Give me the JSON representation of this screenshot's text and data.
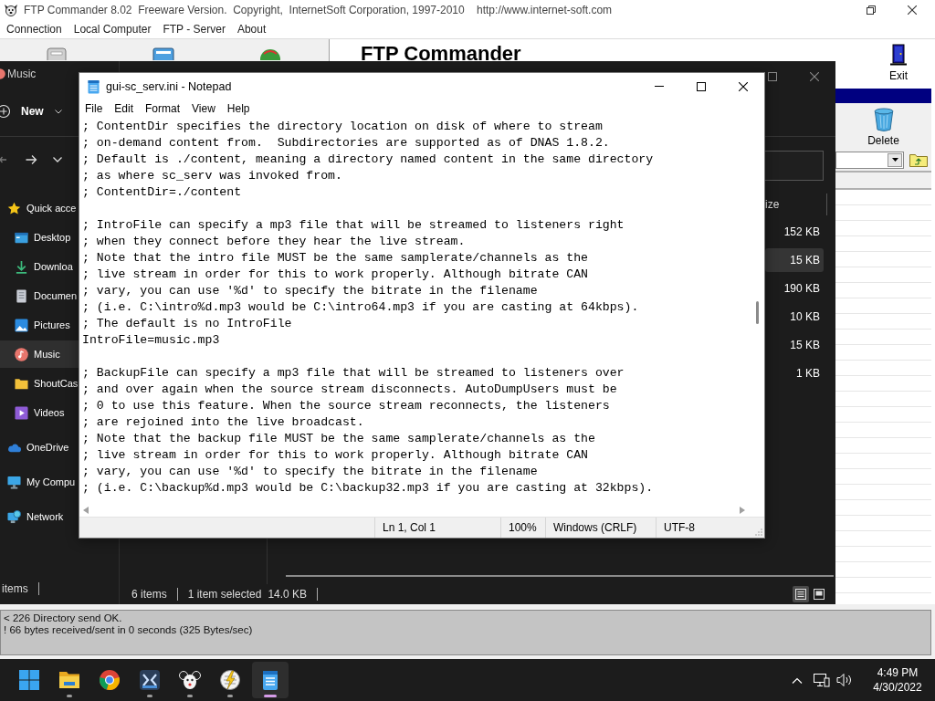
{
  "ftp_commander": {
    "title": "FTP Commander 8.02  Freeware Version.  Copyright,  InternetSoft Corporation, 1997-2010    http://www.internet-soft.com",
    "menu": [
      "Connection",
      "Local Computer",
      "FTP - Server",
      "About"
    ],
    "banner": "FTP Commander",
    "exit_button": "Exit",
    "delete_button": "Delete",
    "log": [
      "< 226 Directory send OK.",
      "! 66 bytes received/sent in 0 seconds (325 Bytes/sec)"
    ]
  },
  "explorer_left": {
    "title": "Music",
    "new_button": "New",
    "nav": [
      {
        "label": "Quick acce",
        "kind": "star",
        "selected": false,
        "children": [
          {
            "label": "Desktop",
            "kind": "desktop",
            "selected": false
          },
          {
            "label": "Downloa",
            "kind": "download",
            "selected": false
          },
          {
            "label": "Documen",
            "kind": "document",
            "selected": false
          },
          {
            "label": "Pictures",
            "kind": "pictures",
            "selected": false
          },
          {
            "label": "Music",
            "kind": "music",
            "selected": true
          },
          {
            "label": "ShoutCas",
            "kind": "folder",
            "selected": false
          },
          {
            "label": "Videos",
            "kind": "videos",
            "selected": false
          }
        ]
      },
      {
        "label": "OneDrive",
        "kind": "cloud",
        "selected": false
      },
      {
        "label": "My Compu",
        "kind": "computer",
        "selected": false
      },
      {
        "label": "Network",
        "kind": "network",
        "selected": false
      }
    ],
    "status": "items"
  },
  "explorer_main": {
    "size_header": "ize",
    "sizes": [
      {
        "text": "152 KB",
        "selected": false
      },
      {
        "text": "15 KB",
        "selected": true
      },
      {
        "text": "190 KB",
        "selected": false
      },
      {
        "text": "10 KB",
        "selected": false
      },
      {
        "text": "15 KB",
        "selected": false
      },
      {
        "text": "1 KB",
        "selected": false
      }
    ],
    "status": {
      "count": "6 items",
      "selection": "1 item selected",
      "size": "14.0 KB"
    },
    "view_buttons": [
      {
        "kind": "details",
        "selected": true
      },
      {
        "kind": "tiles",
        "selected": false
      }
    ]
  },
  "notepad": {
    "title": "gui-sc_serv.ini - Notepad",
    "menu": [
      "File",
      "Edit",
      "Format",
      "View",
      "Help"
    ],
    "paragraphs": [
      [
        "; ContentDir specifies the directory location on disk of where to stream",
        "; on-demand content from.  Subdirectories are supported as of DNAS 1.8.2.",
        "; Default is ./content, meaning a directory named content in the same directory",
        "; as where sc_serv was invoked from.",
        "; ContentDir=./content"
      ],
      [
        "; IntroFile can specify a mp3 file that will be streamed to listeners right",
        "; when they connect before they hear the live stream.",
        "; Note that the intro file MUST be the same samplerate/channels as the",
        "; live stream in order for this to work properly. Although bitrate CAN",
        "; vary, you can use '%d' to specify the bitrate in the filename",
        "; (i.e. C:\\intro%d.mp3 would be C:\\intro64.mp3 if you are casting at 64kbps).",
        "; The default is no IntroFile",
        "IntroFile=music.mp3"
      ],
      [
        "; BackupFile can specify a mp3 file that will be streamed to listeners over",
        "; and over again when the source stream disconnects. AutoDumpUsers must be",
        "; 0 to use this feature. When the source stream reconnects, the listeners",
        "; are rejoined into the live broadcast.",
        "; Note that the backup file MUST be the same samplerate/channels as the",
        "; live stream in order for this to work properly. Although bitrate CAN",
        "; vary, you can use '%d' to specify the bitrate in the filename",
        "; (i.e. C:\\backup%d.mp3 would be C:\\backup32.mp3 if you are casting at 32kbps)."
      ]
    ],
    "status": {
      "position": "Ln 1, Col 1",
      "zoom": "100%",
      "line_ending": "Windows (CRLF)",
      "encoding": "UTF-8"
    }
  },
  "taskbar": {
    "apps": [
      {
        "kind": "start",
        "running": false,
        "selected": false
      },
      {
        "kind": "explorer",
        "running": true,
        "selected": false
      },
      {
        "kind": "browser",
        "running": false,
        "selected": false
      },
      {
        "kind": "player",
        "running": true,
        "selected": false
      },
      {
        "kind": "mouse",
        "running": true,
        "selected": false
      },
      {
        "kind": "radio",
        "running": true,
        "selected": false
      },
      {
        "kind": "notepad",
        "running": true,
        "selected": true
      }
    ],
    "time": "4:49 PM",
    "date": "4/30/2022"
  }
}
